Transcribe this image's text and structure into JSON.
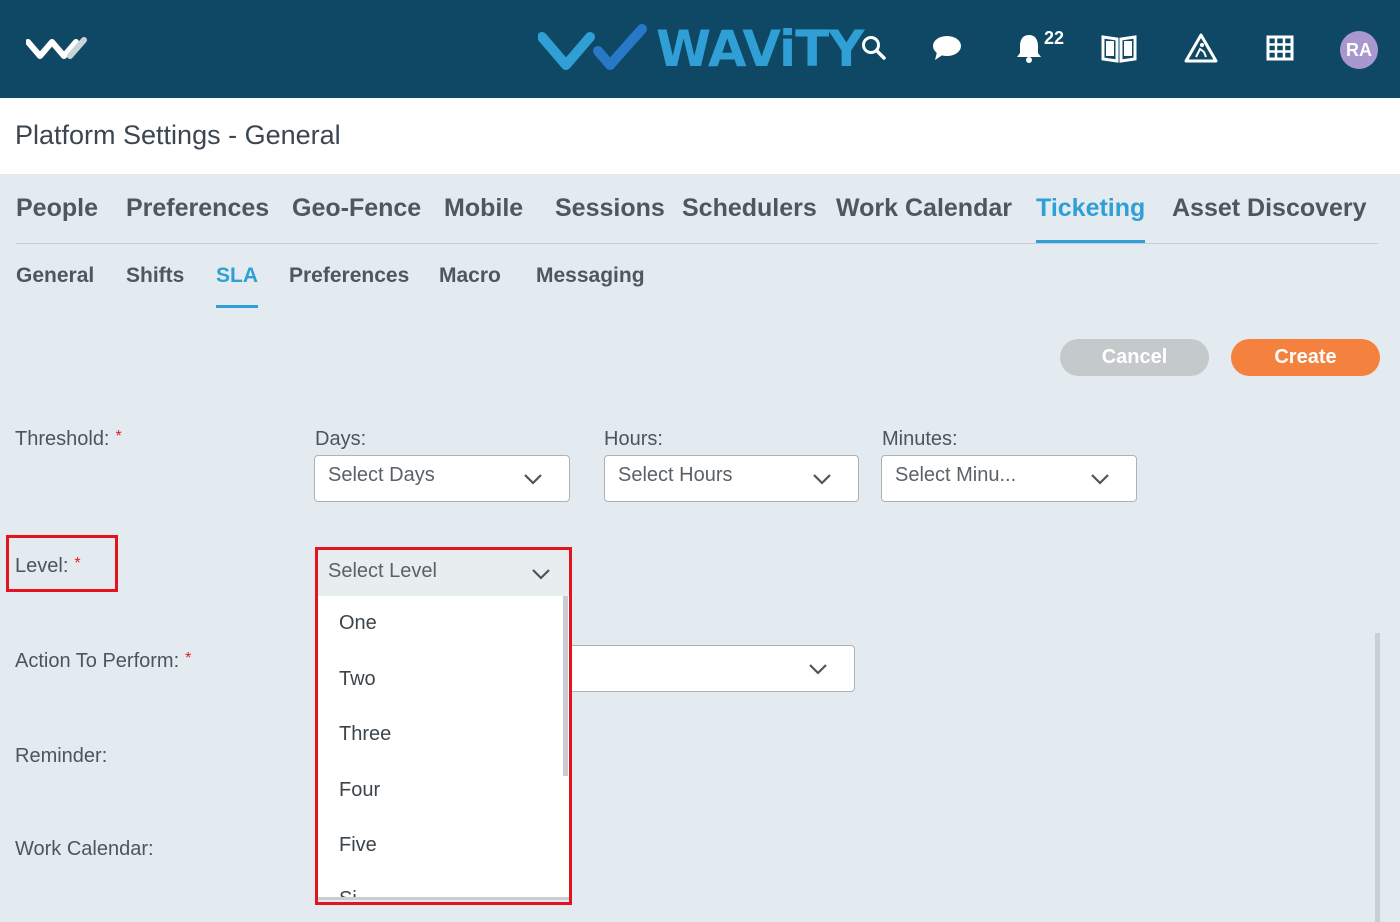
{
  "header": {
    "brand": "WAViTY",
    "notification_count": "22",
    "avatar_initials": "RA",
    "icons": [
      "app-logo-icon",
      "search-icon",
      "chat-icon",
      "bell-icon",
      "book-icon",
      "road-work-icon",
      "grid-icon"
    ]
  },
  "page": {
    "title": "Platform Settings - General"
  },
  "main_tabs": [
    "People",
    "Preferences",
    "Geo-Fence",
    "Mobile",
    "Sessions",
    "Schedulers",
    "Work Calendar",
    "Ticketing",
    "Asset Discovery"
  ],
  "main_tab_active": "Ticketing",
  "sub_tabs": [
    "General",
    "Shifts",
    "SLA",
    "Preferences",
    "Macro",
    "Messaging"
  ],
  "sub_tab_active": "SLA",
  "actions": {
    "cancel": "Cancel",
    "create": "Create"
  },
  "form": {
    "threshold_label": "Threshold:",
    "required_mark": "*",
    "days_label": "Days:",
    "days_placeholder": "Select Days",
    "hours_label": "Hours:",
    "hours_placeholder": "Select Hours",
    "minutes_label": "Minutes:",
    "minutes_placeholder": "Select Minu...",
    "level_label": "Level:",
    "level_placeholder": "Select Level",
    "level_options": [
      "One",
      "Two",
      "Three",
      "Four",
      "Five",
      "Si"
    ],
    "action_label": "Action To Perform:",
    "reminder_label": "Reminder:",
    "work_calendar_label": "Work Calendar:"
  },
  "colors": {
    "header_bg": "#0f4864",
    "accent": "#2f9fd6",
    "create": "#f5813f",
    "cancel": "#c4c9cc",
    "highlight": "#e3141d"
  }
}
